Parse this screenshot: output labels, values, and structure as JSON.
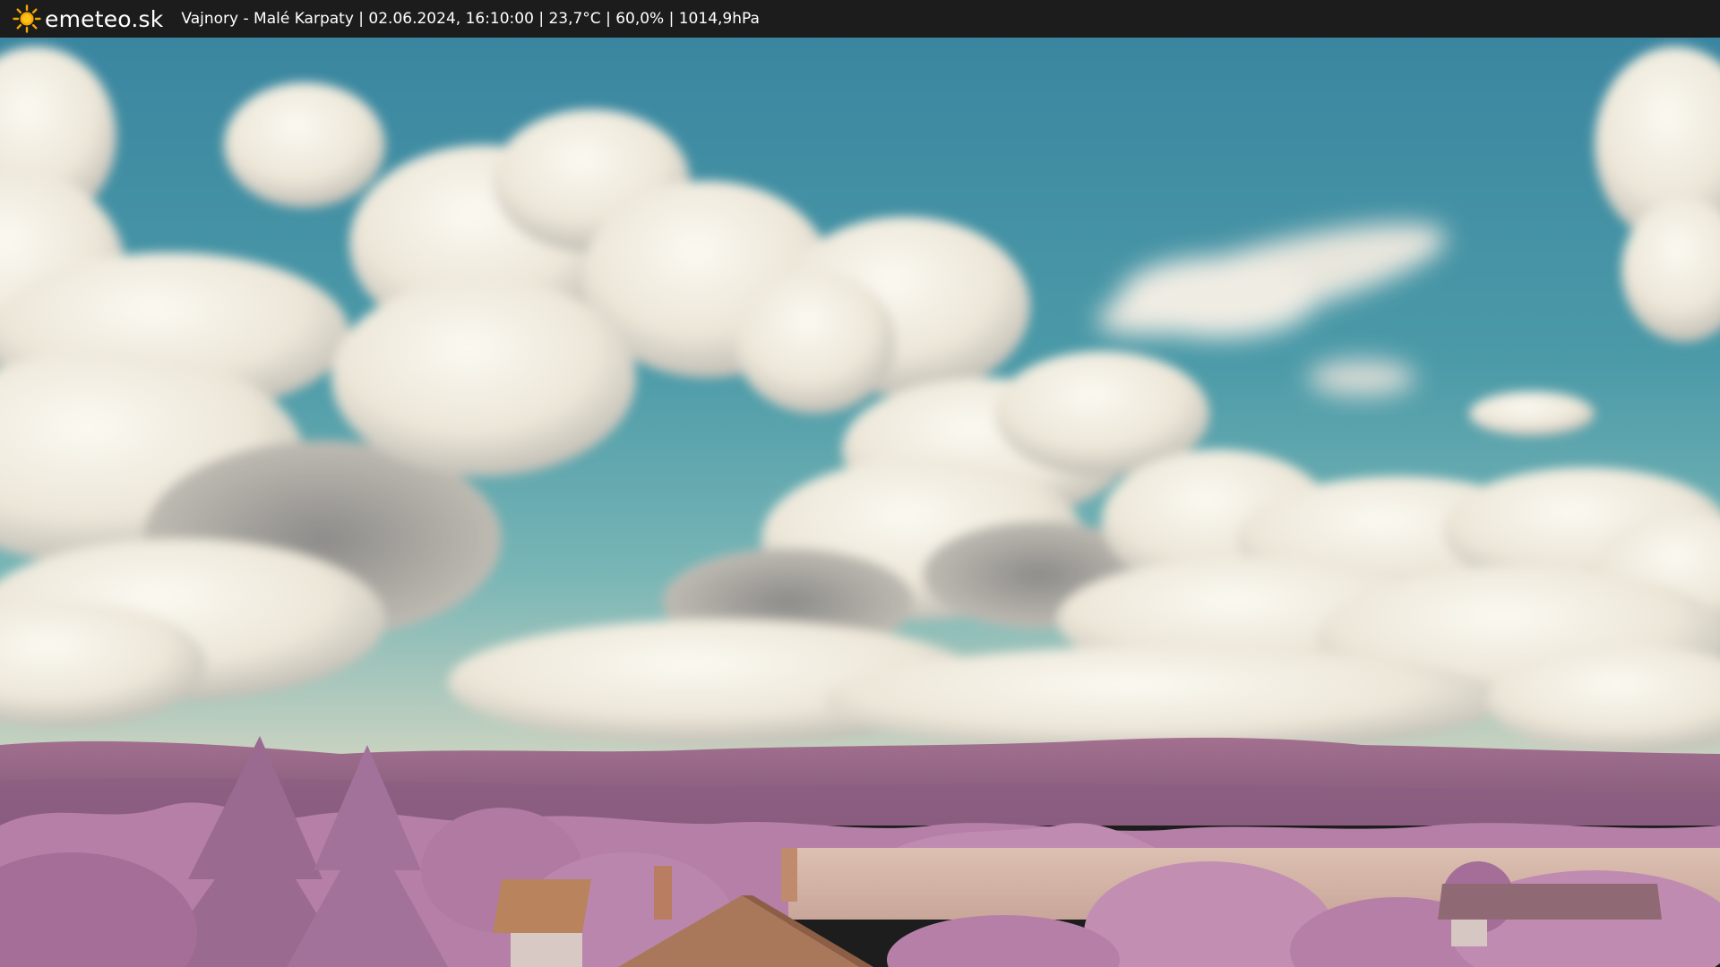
{
  "header": {
    "site_name": "emeteo.sk",
    "logo_icon": "sun-icon",
    "caption": "Vajnory - Malé Karpaty | 02.06.2024, 16:10:00 | 23,7°C | 60,0% | 1014,9hPa"
  },
  "colors": {
    "bar_background": "#1c1c1c",
    "bar_text": "#ffffff",
    "sun_color": "#f5a800",
    "sky_top": "#3c8aa0",
    "sky_bottom": "#7bb8bd",
    "cloud": "#f2efe6",
    "hills": "#9a6a92",
    "trees": "#b27aa6",
    "field": "#d9b7ad",
    "roof": "#b08060"
  }
}
